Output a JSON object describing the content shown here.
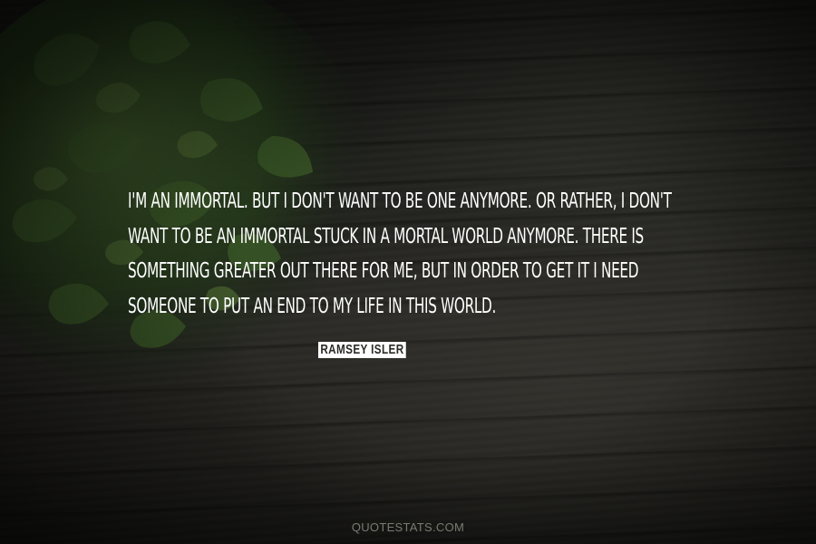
{
  "quote": {
    "lines": [
      "I'M AN IMMORTAL. BUT I DON'T WANT TO BE ONE ANYMORE. OR RATHER, I DON'T",
      "WANT TO BE AN IMMORTAL STUCK IN A MORTAL WORLD ANYMORE. THERE IS",
      "SOMETHING GREATER OUT THERE FOR ME, BUT IN ORDER TO GET IT I NEED",
      "SOMEONE TO PUT AN END TO MY LIFE IN THIS WORLD."
    ],
    "color": "#ffffff"
  },
  "author": {
    "name": "RAMSEY ISLER"
  },
  "watermark": {
    "text": "QUOTESTATS.COM"
  },
  "colors": {
    "background": "#2b2b27",
    "foliage": "#3c5a2a",
    "author_label_bg": "#ffffff"
  }
}
